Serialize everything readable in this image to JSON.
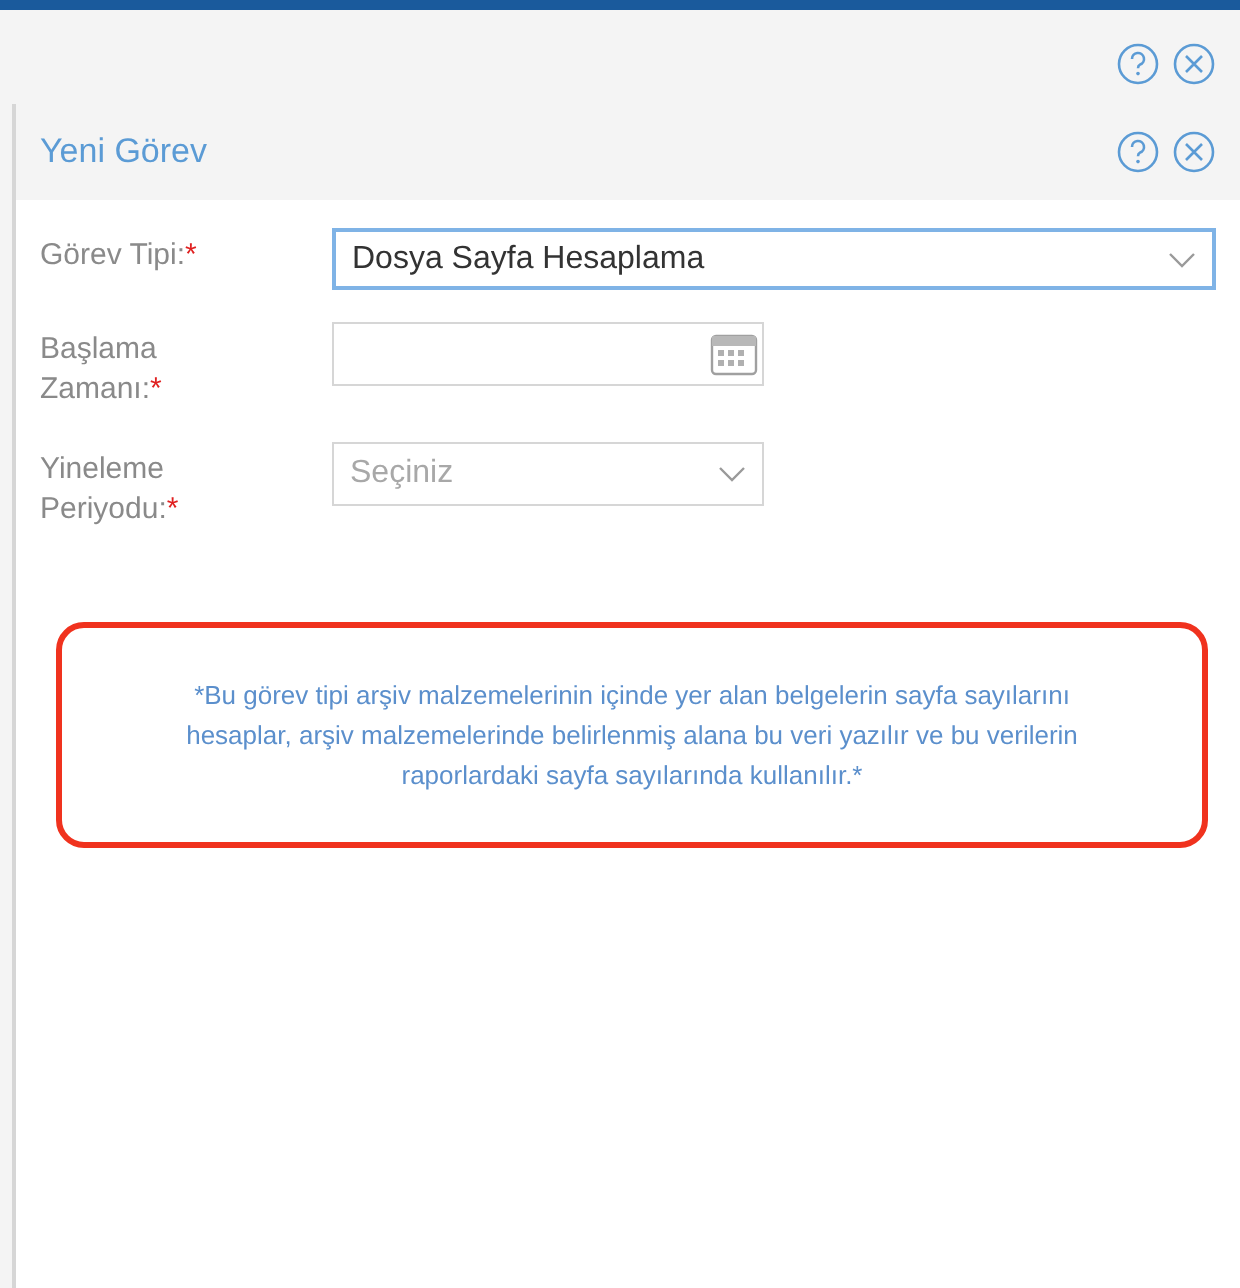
{
  "dialog": {
    "title": "Yeni Görev"
  },
  "fields": [
    {
      "kind": "select",
      "label": "Görev Tipi:",
      "required_mark": "*",
      "value": "Dosya Sayfa Hesaplama",
      "focused": true
    },
    {
      "kind": "date",
      "label": "Başlama Zamanı:",
      "required_mark": "*",
      "focused": false
    },
    {
      "kind": "select",
      "label": "Yineleme Periyodu:",
      "required_mark": "*",
      "placeholder": "Seçiniz",
      "focused": false
    }
  ],
  "note": "*Bu görev tipi arşiv malzemelerinin içinde yer alan belgelerin sayfa sayılarını hesaplar, arşiv malzemelerinde belirlenmiş alana bu veri yazılır ve bu verilerin raporlardaki sayfa sayılarında kullanılır.*"
}
